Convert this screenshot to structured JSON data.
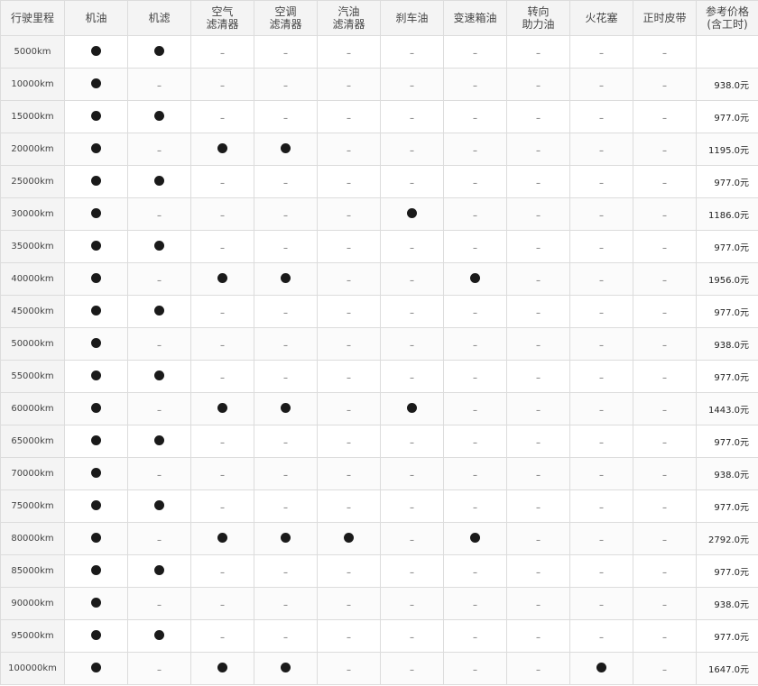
{
  "headers": [
    {
      "id": "mileage",
      "lines": [
        "行驶里程"
      ]
    },
    {
      "id": "engine-oil",
      "lines": [
        "机油"
      ]
    },
    {
      "id": "oil-filter",
      "lines": [
        "机滤"
      ]
    },
    {
      "id": "air-filter",
      "lines": [
        "空气",
        "滤清器"
      ]
    },
    {
      "id": "ac-filter",
      "lines": [
        "空调",
        "滤清器"
      ]
    },
    {
      "id": "fuel-filter",
      "lines": [
        "汽油",
        "滤清器"
      ]
    },
    {
      "id": "brake-fluid",
      "lines": [
        "刹车油"
      ]
    },
    {
      "id": "transmission-oil",
      "lines": [
        "变速箱油"
      ]
    },
    {
      "id": "power-steering-fluid",
      "lines": [
        "转向",
        "助力油"
      ]
    },
    {
      "id": "spark-plug",
      "lines": [
        "火花塞"
      ]
    },
    {
      "id": "timing-belt",
      "lines": [
        "正时皮带"
      ]
    },
    {
      "id": "price",
      "lines": [
        "参考价格",
        "(含工时)"
      ]
    }
  ],
  "dash": "–",
  "rows": [
    {
      "km": "5000km",
      "items": [
        1,
        1,
        0,
        0,
        0,
        0,
        0,
        0,
        0,
        0
      ],
      "price": ""
    },
    {
      "km": "10000km",
      "items": [
        1,
        0,
        0,
        0,
        0,
        0,
        0,
        0,
        0,
        0
      ],
      "price": "938.0元"
    },
    {
      "km": "15000km",
      "items": [
        1,
        1,
        0,
        0,
        0,
        0,
        0,
        0,
        0,
        0
      ],
      "price": "977.0元"
    },
    {
      "km": "20000km",
      "items": [
        1,
        0,
        1,
        1,
        0,
        0,
        0,
        0,
        0,
        0
      ],
      "price": "1195.0元"
    },
    {
      "km": "25000km",
      "items": [
        1,
        1,
        0,
        0,
        0,
        0,
        0,
        0,
        0,
        0
      ],
      "price": "977.0元"
    },
    {
      "km": "30000km",
      "items": [
        1,
        0,
        0,
        0,
        0,
        1,
        0,
        0,
        0,
        0
      ],
      "price": "1186.0元"
    },
    {
      "km": "35000km",
      "items": [
        1,
        1,
        0,
        0,
        0,
        0,
        0,
        0,
        0,
        0
      ],
      "price": "977.0元"
    },
    {
      "km": "40000km",
      "items": [
        1,
        0,
        1,
        1,
        0,
        0,
        1,
        0,
        0,
        0
      ],
      "price": "1956.0元"
    },
    {
      "km": "45000km",
      "items": [
        1,
        1,
        0,
        0,
        0,
        0,
        0,
        0,
        0,
        0
      ],
      "price": "977.0元"
    },
    {
      "km": "50000km",
      "items": [
        1,
        0,
        0,
        0,
        0,
        0,
        0,
        0,
        0,
        0
      ],
      "price": "938.0元"
    },
    {
      "km": "55000km",
      "items": [
        1,
        1,
        0,
        0,
        0,
        0,
        0,
        0,
        0,
        0
      ],
      "price": "977.0元"
    },
    {
      "km": "60000km",
      "items": [
        1,
        0,
        1,
        1,
        0,
        1,
        0,
        0,
        0,
        0
      ],
      "price": "1443.0元"
    },
    {
      "km": "65000km",
      "items": [
        1,
        1,
        0,
        0,
        0,
        0,
        0,
        0,
        0,
        0
      ],
      "price": "977.0元"
    },
    {
      "km": "70000km",
      "items": [
        1,
        0,
        0,
        0,
        0,
        0,
        0,
        0,
        0,
        0
      ],
      "price": "938.0元"
    },
    {
      "km": "75000km",
      "items": [
        1,
        1,
        0,
        0,
        0,
        0,
        0,
        0,
        0,
        0
      ],
      "price": "977.0元"
    },
    {
      "km": "80000km",
      "items": [
        1,
        0,
        1,
        1,
        1,
        0,
        1,
        0,
        0,
        0
      ],
      "price": "2792.0元"
    },
    {
      "km": "85000km",
      "items": [
        1,
        1,
        0,
        0,
        0,
        0,
        0,
        0,
        0,
        0
      ],
      "price": "977.0元"
    },
    {
      "km": "90000km",
      "items": [
        1,
        0,
        0,
        0,
        0,
        0,
        0,
        0,
        0,
        0
      ],
      "price": "938.0元"
    },
    {
      "km": "95000km",
      "items": [
        1,
        1,
        0,
        0,
        0,
        0,
        0,
        0,
        0,
        0
      ],
      "price": "977.0元"
    },
    {
      "km": "100000km",
      "items": [
        1,
        0,
        1,
        1,
        0,
        0,
        0,
        0,
        1,
        0
      ],
      "price": "1647.0元"
    }
  ]
}
